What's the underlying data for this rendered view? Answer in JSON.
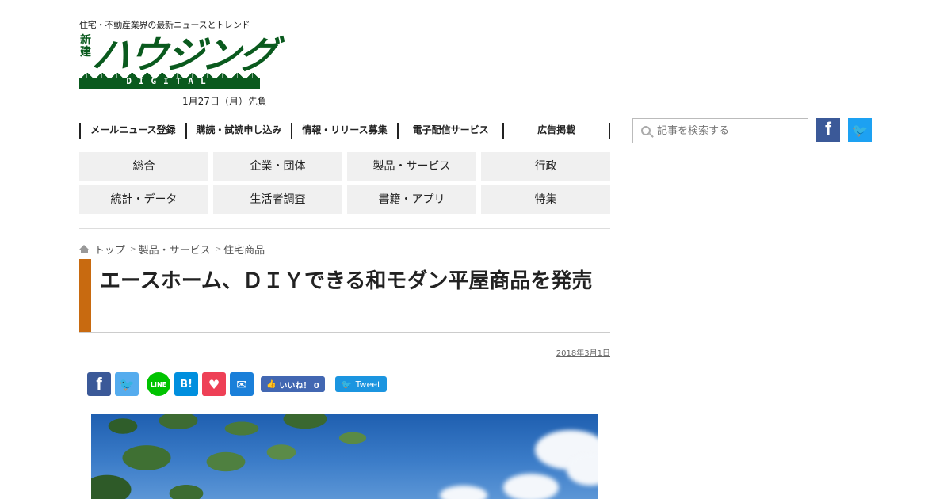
{
  "header": {
    "tagline": "住宅・不動産業界の最新ニュースとトレンド",
    "logo_vertical": "新建",
    "logo_main": "ハウジング",
    "logo_sub": "DIGITAL",
    "date_line": "1月27日（月）先負"
  },
  "topnav": {
    "items": [
      "メールニュース登録",
      "購読・試読申し込み",
      "情報・リリース募集",
      "電子配信サービス",
      "広告掲載"
    ]
  },
  "search": {
    "placeholder": "記事を検索する",
    "icon": "search-icon"
  },
  "social_top": {
    "facebook_glyph": "f",
    "twitter_glyph": "🐦"
  },
  "categories": {
    "items": [
      "総合",
      "企業・団体",
      "製品・サービス",
      "行政",
      "統計・データ",
      "生活者調査",
      "書籍・アプリ",
      "特集"
    ]
  },
  "breadcrumb": {
    "items": [
      "トップ",
      "製品・サービス",
      "住宅商品"
    ],
    "separator": ">"
  },
  "article": {
    "title": "エースホーム、ＤＩＹできる和モダン平屋商品を発売",
    "date": "2018年3月1日",
    "accent_color": "#c86a10"
  },
  "share": {
    "facebook_glyph": "f",
    "twitter_glyph": "🐦",
    "line_label": "LINE",
    "hatena_label": "B!",
    "pocket_glyph": "♥",
    "mail_glyph": "✉",
    "like_label": "いいね！ 0",
    "like_glyph": "👍",
    "tweet_label": "Tweet",
    "tweet_glyph": "🐦"
  },
  "colors": {
    "brand_green": "#0a5a1e",
    "facebook": "#3b5998",
    "twitter": "#1da1f2"
  }
}
